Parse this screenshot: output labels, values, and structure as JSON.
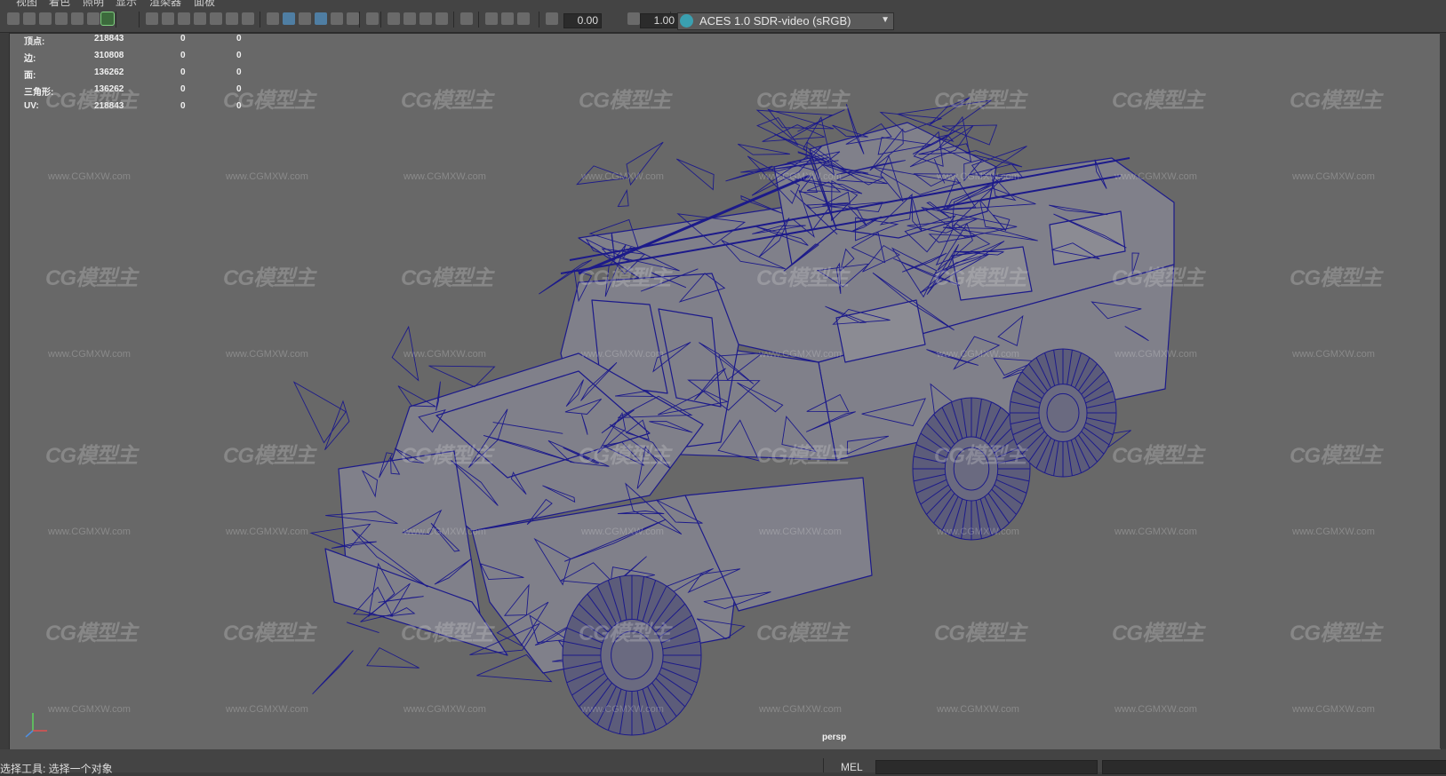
{
  "menu": [
    "视图",
    "着色",
    "照明",
    "显示",
    "渲染器",
    "面板"
  ],
  "toolbar": {
    "exposure_value": "0.00",
    "gamma_value": "1.00",
    "color_management": "ACES 1.0 SDR-video (sRGB)"
  },
  "hud": {
    "rows": [
      {
        "label": "顶点:",
        "a": "218843",
        "b": "0",
        "c": "0"
      },
      {
        "label": "边:",
        "a": "310808",
        "b": "0",
        "c": "0"
      },
      {
        "label": "面:",
        "a": "136262",
        "b": "0",
        "c": "0"
      },
      {
        "label": "三角形:",
        "a": "136262",
        "b": "0",
        "c": "0"
      },
      {
        "label": "UV:",
        "a": "218843",
        "b": "0",
        "c": "0"
      }
    ]
  },
  "watermark": {
    "logo": "CG模型主",
    "url": "www.CGMXW.com"
  },
  "camera_label": "persp",
  "status": {
    "help_line": "选择工具: 选择一个对象",
    "command_label": "MEL"
  },
  "colors": {
    "viewport_bg": "#686868",
    "wire": "#1c1a8a",
    "shade": "#7e7e84"
  }
}
